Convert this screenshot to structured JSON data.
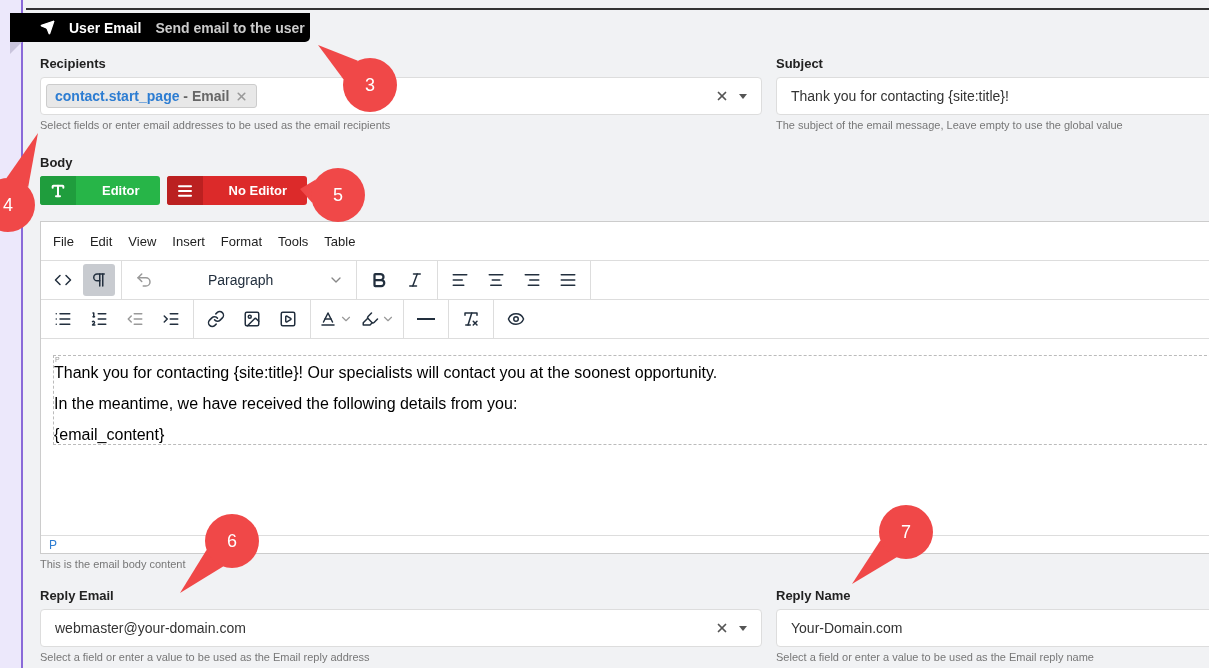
{
  "action_header": {
    "title": "User Email",
    "description": "Send email to the user"
  },
  "recipients": {
    "label": "Recipients",
    "tags": [
      {
        "field": "contact.start_page",
        "suffix": " - Email"
      }
    ],
    "hint": "Select fields or enter email addresses to be used as the email recipients"
  },
  "subject": {
    "label": "Subject",
    "value": "Thank you for contacting {site:title}!",
    "hint": "The subject of the email message, Leave empty to use the global value"
  },
  "body": {
    "label": "Body",
    "modes": [
      {
        "label": "Editor",
        "kind": "editor"
      },
      {
        "label": "No Editor",
        "kind": "plain"
      }
    ],
    "menu": [
      "File",
      "Edit",
      "View",
      "Insert",
      "Format",
      "Tools",
      "Table"
    ],
    "block_format": "Paragraph",
    "visual_blocks_active": true,
    "block_tag": "P",
    "paragraphs": [
      "Thank you for contacting {site:title}! Our specialists will contact you at the soonest opportunity.",
      "In the meantime, we have received the following details from you:",
      "{email_content}"
    ],
    "status_path": "P",
    "hint": "This is the email body content"
  },
  "reply_email": {
    "label": "Reply Email",
    "value": "webmaster@your-domain.com",
    "hint": "Select a field or enter a value to be used as the Email reply address"
  },
  "reply_name": {
    "label": "Reply Name",
    "value": "Your-Domain.com",
    "hint": "Select a field or enter a value to be used as the Email reply name"
  },
  "callouts": [
    {
      "number": "3"
    },
    {
      "number": "4"
    },
    {
      "number": "5"
    },
    {
      "number": "6"
    },
    {
      "number": "7"
    }
  ]
}
